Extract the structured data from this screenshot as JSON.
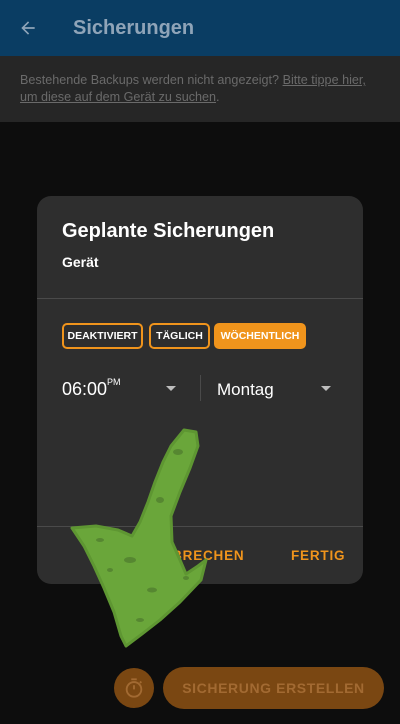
{
  "appbar": {
    "title": "Sicherungen",
    "back_icon": "arrow-left-icon"
  },
  "info": {
    "text": "Bestehende Backups werden nicht angezeigt? ",
    "link": "Bitte tippe hier, um diese auf dem Gerät zu suchen",
    "suffix": "."
  },
  "dialog": {
    "title": "Geplante Sicherungen",
    "subtitle": "Gerät",
    "segments": [
      {
        "label": "DEAKTIVIERT",
        "active": false
      },
      {
        "label": "TÄGLICH",
        "active": false
      },
      {
        "label": "WÖCHENTLICH",
        "active": true
      }
    ],
    "time": {
      "value": "06:00",
      "suffix": "PM"
    },
    "day": "Montag",
    "cancel_label": "ABBRECHEN",
    "done_label": "FERTIG"
  },
  "actions": {
    "timer_icon": "timer-icon",
    "create_label": "SICHERUNG ERSTELLEN"
  },
  "colors": {
    "appbar": "#0a3d63",
    "accent": "#f0941c",
    "dialog_bg": "#2e2e2e",
    "overlay_arrow": "#6aa63a"
  }
}
